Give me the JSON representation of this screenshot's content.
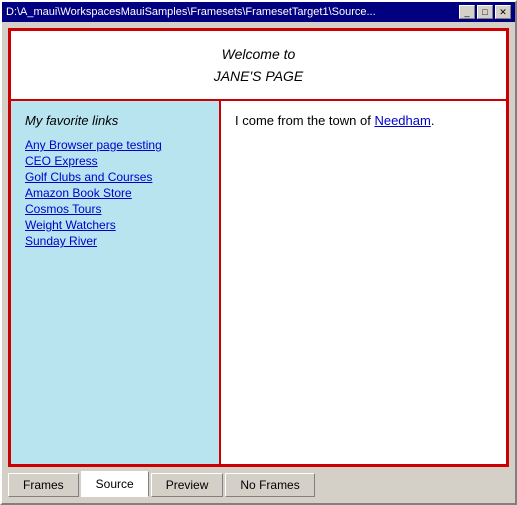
{
  "window": {
    "title": "D:\\A_maui\\WorkspacesMauiSamples\\Framesets\\FramesetTarget1\\Source...",
    "title_buttons": {
      "minimize": "_",
      "maximize": "□",
      "close": "✕"
    }
  },
  "top_frame": {
    "line1": "Welcome to",
    "line2": "JANE'S PAGE"
  },
  "left_frame": {
    "heading": "My favorite links",
    "links": [
      "Any Browser page testing",
      "CEO Express",
      "Golf Clubs and Courses",
      "Amazon Book Store",
      "Cosmos Tours",
      "Weight Watchers",
      "Sunday River"
    ]
  },
  "right_frame": {
    "text_before": "I come from the town of ",
    "link_text": "Needham",
    "text_after": "."
  },
  "tabs": [
    {
      "label": "Frames",
      "active": false
    },
    {
      "label": "Source",
      "active": true
    },
    {
      "label": "Preview",
      "active": false
    },
    {
      "label": "No Frames",
      "active": false
    }
  ]
}
